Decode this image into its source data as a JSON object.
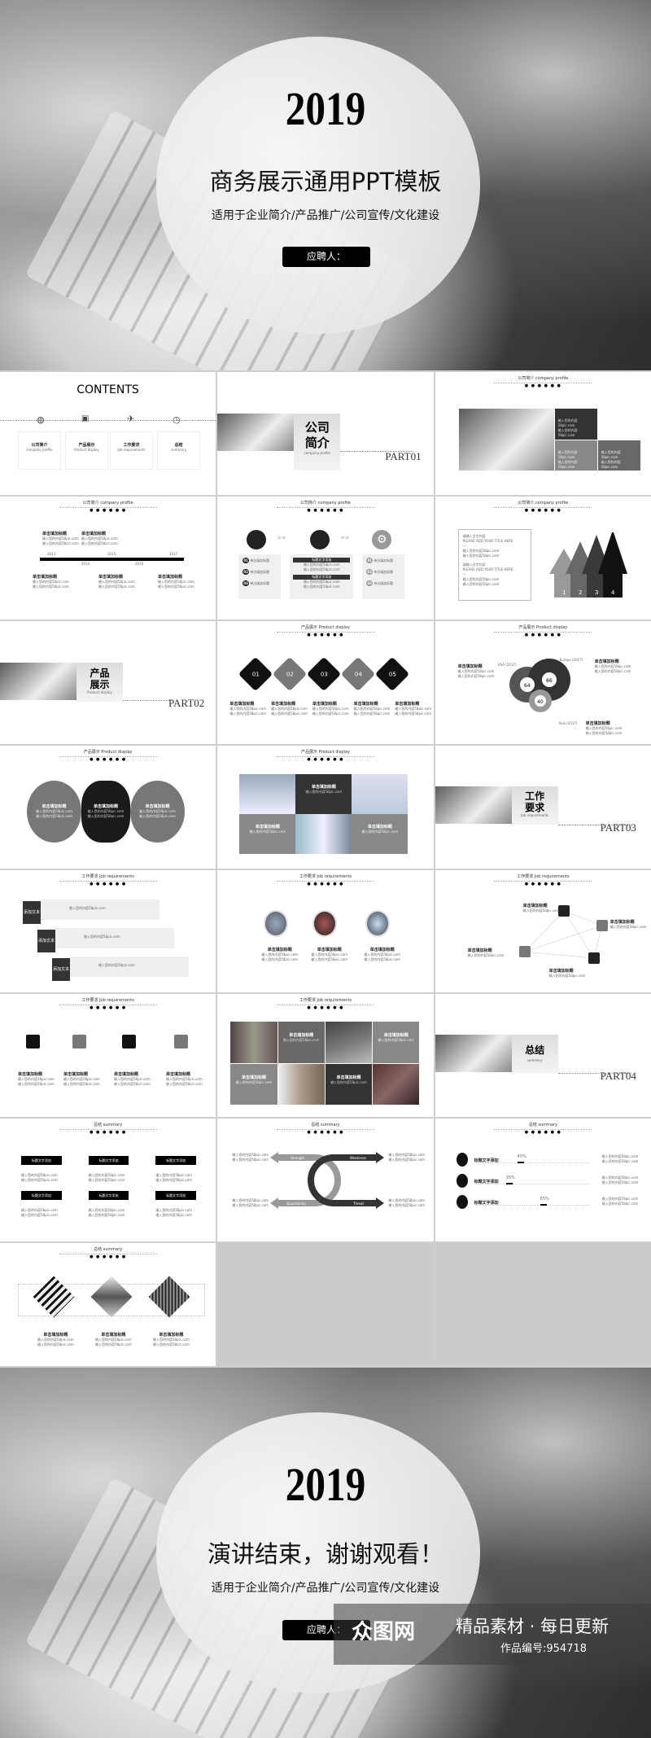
{
  "cover": {
    "year": "2019",
    "title": "商务展示通用PPT模板",
    "subtitle": "适用于企业简介/产品推广/公司宣传/文化建设",
    "button": "应聘人："
  },
  "ending": {
    "year": "2019",
    "title": "演讲结束，谢谢观看！",
    "subtitle": "适用于企业简介/产品推广/公司宣传/文化建设",
    "button": "应聘人："
  },
  "watermark": {
    "brand": "众图网",
    "slogan": "精品素材 · 每日更新",
    "code": "作品编号:954718"
  },
  "headers": {
    "profile": "公司简介  company profile",
    "product": "产品展示 Product display",
    "job": "工作要求  Job requirements",
    "summary": "总结  summary",
    "dots": "● ● ● ● ● ●"
  },
  "contents": {
    "title": "CONTENTS",
    "items": [
      {
        "cn": "公司简介",
        "en": "company profile"
      },
      {
        "cn": "产品展示",
        "en": "Product display"
      },
      {
        "cn": "工作要求",
        "en": "Job requirements"
      },
      {
        "cn": "总结",
        "en": "summary"
      }
    ]
  },
  "parts": [
    {
      "cn1": "公司",
      "cn2": "简介",
      "en": "company profile",
      "label": "PART01"
    },
    {
      "cn1": "产品",
      "cn2": "展示",
      "en": "Product display",
      "label": "PART02"
    },
    {
      "cn1": "工作",
      "cn2": "要求",
      "en": "Job requirements",
      "label": "PART03"
    },
    {
      "cn1": "总结",
      "cn2": "",
      "en": "summary",
      "label": "PART04"
    }
  ],
  "ph": {
    "title": "单击填加标题",
    "line": "输入您的内容58pic.com",
    "addtext": "添加文本",
    "title_text": "标题文字添加",
    "tag": "标题文字添加",
    "en_title": "PLEASE ADD YOUR TITLE HERE",
    "sub_title": "请输入文字内容"
  },
  "timeline": {
    "years": [
      "2013",
      "2014",
      "2015",
      "2016",
      "2017"
    ]
  },
  "steps": [
    "01",
    "02",
    "03",
    "04",
    "05"
  ],
  "numbered": [
    "01",
    "02",
    "03"
  ],
  "arrows": [
    "1",
    "2",
    "3",
    "4"
  ],
  "venn": {
    "values": [
      "64",
      "86",
      "40"
    ],
    "labels": [
      "USA (2017)",
      "Europe (2017)",
      "Asia (2017)"
    ]
  },
  "swot": [
    "Strength",
    "Weakness",
    "Opportunity",
    "Threat"
  ],
  "progress": [
    {
      "value": 45,
      "label": "45%"
    },
    {
      "value": 35,
      "label": "35%"
    },
    {
      "value": 65,
      "label": "65%"
    }
  ]
}
